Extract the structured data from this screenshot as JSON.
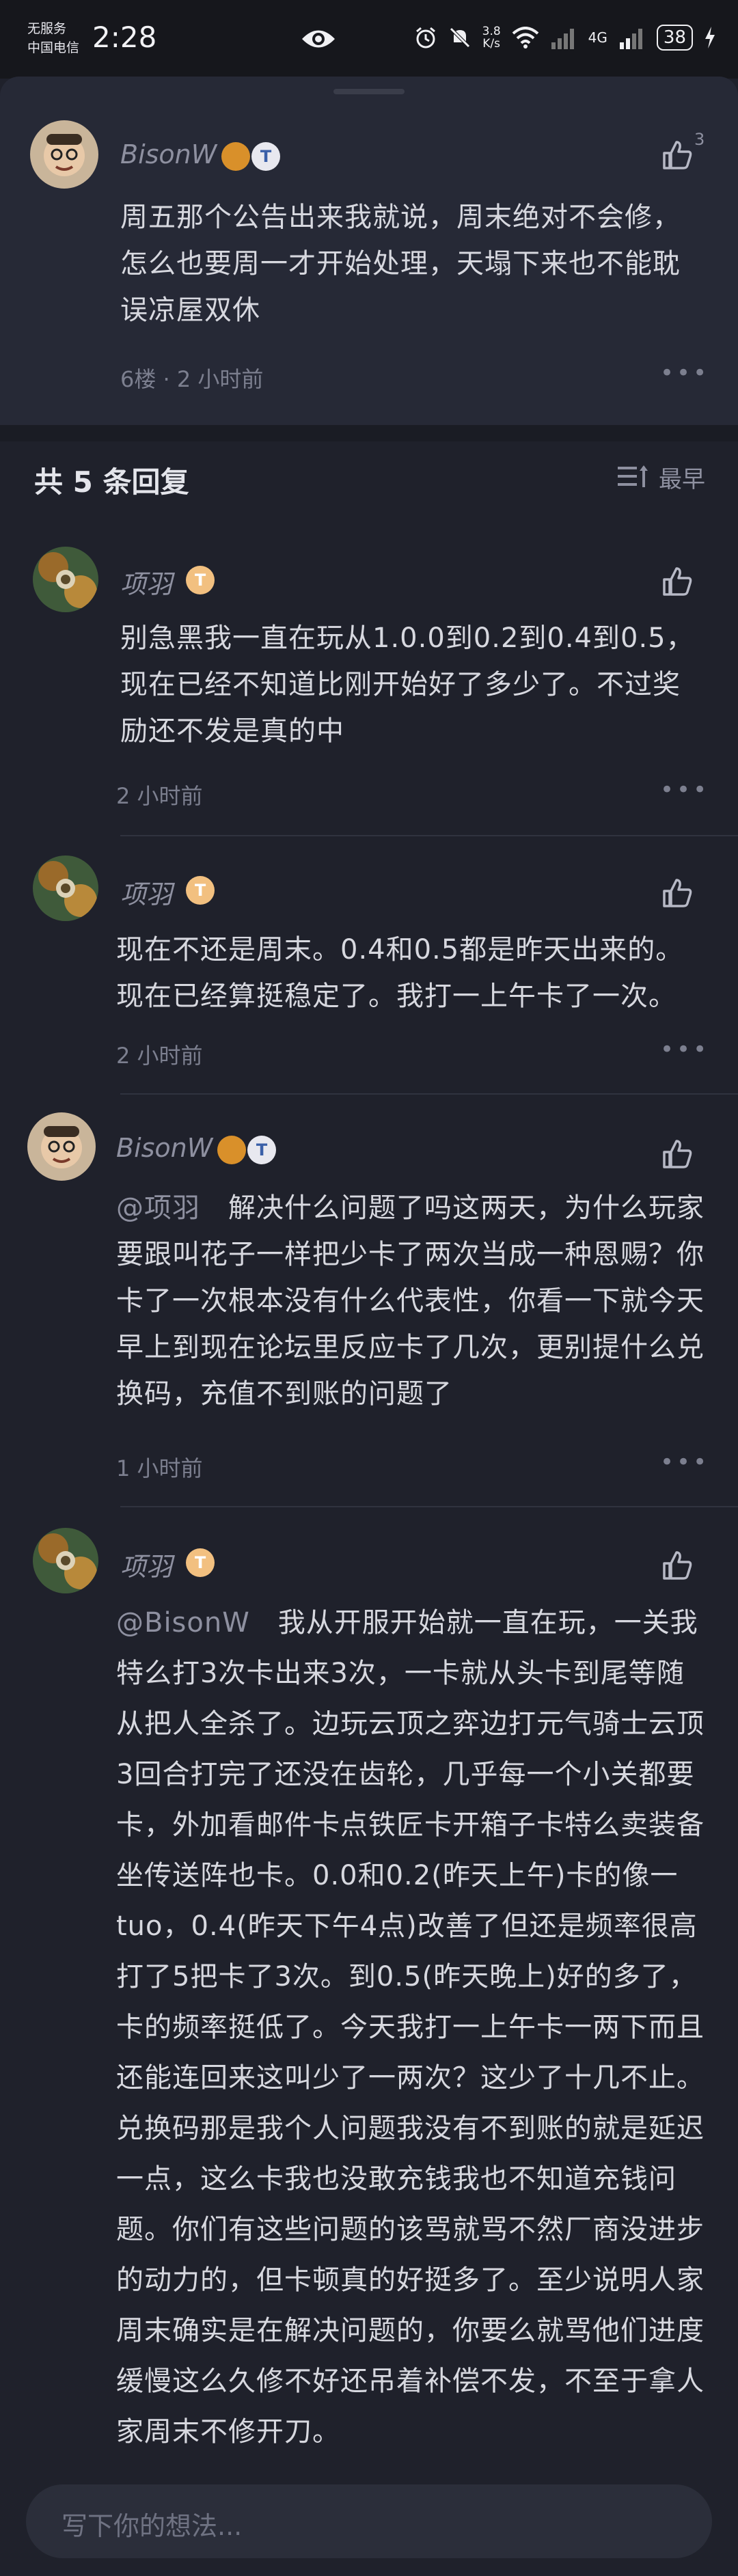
{
  "status_bar": {
    "carrier_line1": "无服务",
    "carrier_line2": "中国电信",
    "time": "2:28",
    "net_speed_value": "3.8",
    "net_speed_unit": "K/s",
    "signal_label": "4G",
    "battery": "38"
  },
  "main_comment": {
    "username": "BisonW",
    "like_count": "3",
    "text": "周五那个公告出来我就说，周末绝对不会修，怎么也要周一才开始处理，天塌下来也不能耽误凉屋双休",
    "meta": "6楼 · 2 小时前"
  },
  "replies_header": {
    "title": "共 5 条回复",
    "sort_label": "最早"
  },
  "replies": [
    {
      "username": "项羽",
      "text": "别急黑我一直在玩从1.0.0到0.2到0.4到0.5，现在已经不知道比刚开始好了多少了。不过奖励还不发是真的中",
      "time": "2 小时前"
    },
    {
      "username": "项羽",
      "text": "现在不还是周末。0.4和0.5都是昨天出来的。现在已经算挺稳定了。我打一上午卡了一次。",
      "time": "2 小时前"
    },
    {
      "username": "BisonW",
      "mention": "@项羽",
      "text": "解决什么问题了吗这两天，为什么玩家要跟叫花子一样把少卡了两次当成一种恩赐？你卡了一次根本没有什么代表性，你看一下就今天早上到现在论坛里反应卡了几次，更别提什么兑换码，充值不到账的问题了",
      "time": "1 小时前"
    },
    {
      "username": "项羽",
      "mention": "@BisonW",
      "text": "我从开服开始就一直在玩，一关我特么打3次卡出来3次，一卡就从头卡到尾等随从把人全杀了。边玩云顶之弈边打元气骑士云顶3回合打完了还没在齿轮，几乎每一个小关都要卡，外加看邮件卡点铁匠卡开箱子卡特么卖装备坐传送阵也卡。0.0和0.2(昨天上午)卡的像一tuo，0.4(昨天下午4点)改善了但还是频率很高打了5把卡了3次。到0.5(昨天晚上)好的多了，卡的频率挺低了。今天我打一上午卡一两下而且还能连回来这叫少了一两次？这少了十几不止。兑换码那是我个人问题我没有不到账的就是延迟一点，这么卡我也没敢充钱我也不知道充钱问题。你们有这些问题的该骂就骂不然厂商没进步的动力的，但卡顿真的好挺多了。至少说明人家周末确实是在解决问题的，你要么就骂他们进度缓慢这么久修不好还吊着补偿不发，不至于拿人家周末不修开刀。",
      "time": ""
    }
  ],
  "input": {
    "placeholder": "写下你的想法..."
  },
  "colors": {
    "background": "#1f212b",
    "panel": "#262936",
    "text": "#d7d8df",
    "muted": "#7c7f8f"
  }
}
